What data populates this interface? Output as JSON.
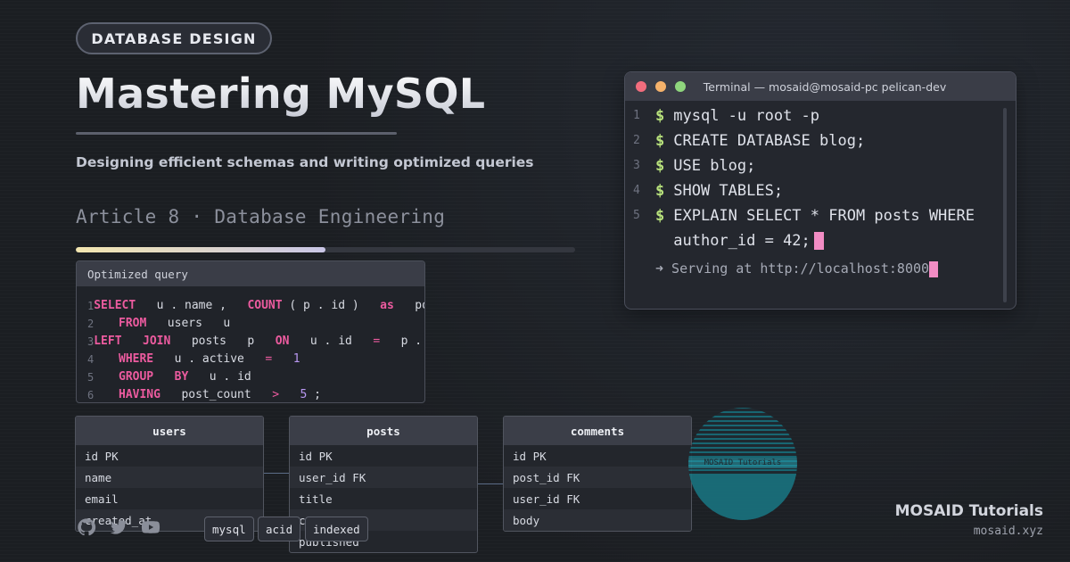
{
  "header": {
    "category": "DATABASE DESIGN",
    "title": "Mastering MySQL",
    "subtitle": "Designing efficient schemas and writing optimized queries",
    "article": "Article 8 · Database Engineering",
    "reading_progress": 0.5
  },
  "query_card": {
    "title": "Optimized query",
    "lines": [
      {
        "n": "1",
        "tokens": [
          [
            "kw",
            "SELECT"
          ],
          [
            "id",
            "   u . name ,   "
          ],
          [
            "kw",
            "COUNT"
          ],
          [
            "id",
            " ( p . id )   "
          ],
          [
            "kw",
            "as"
          ],
          [
            "id",
            "   post_count"
          ]
        ]
      },
      {
        "n": "2",
        "tokens": [
          [
            "kw",
            "FROM"
          ],
          [
            "id",
            "   users   u"
          ]
        ]
      },
      {
        "n": "3",
        "tokens": [
          [
            "kw",
            "LEFT"
          ],
          [
            "id",
            "   "
          ],
          [
            "kw",
            "JOIN"
          ],
          [
            "id",
            "   posts   p   "
          ],
          [
            "kw",
            "ON"
          ],
          [
            "id",
            "   u . id   "
          ],
          [
            "op",
            "="
          ],
          [
            "id",
            "   p . user_id"
          ]
        ]
      },
      {
        "n": "4",
        "tokens": [
          [
            "kw",
            "WHERE"
          ],
          [
            "id",
            "   u . active   "
          ],
          [
            "op",
            "="
          ],
          [
            "id",
            "   "
          ],
          [
            "num",
            "1"
          ]
        ]
      },
      {
        "n": "5",
        "tokens": [
          [
            "kw",
            "GROUP"
          ],
          [
            "id",
            "   "
          ],
          [
            "kw",
            "BY"
          ],
          [
            "id",
            "   u . id"
          ]
        ]
      },
      {
        "n": "6",
        "tokens": [
          [
            "kw",
            "HAVING"
          ],
          [
            "id",
            "   post_count   "
          ],
          [
            "op",
            ">"
          ],
          [
            "id",
            "   "
          ],
          [
            "num",
            "5"
          ],
          [
            "id",
            " ;"
          ]
        ]
      }
    ]
  },
  "terminal": {
    "title": "Terminal — mosaid@mosaid-pc pelican-dev",
    "prompt": "$",
    "lines": [
      {
        "n": "1",
        "cmd": "mysql -u root -p"
      },
      {
        "n": "2",
        "cmd": "CREATE DATABASE blog;"
      },
      {
        "n": "3",
        "cmd": "USE blog;"
      },
      {
        "n": "4",
        "cmd": "SHOW TABLES;"
      },
      {
        "n": "5",
        "cmd": "EXPLAIN SELECT * FROM posts WHERE\nauthor_id = 42;"
      }
    ],
    "serving": "➜ Serving at http://localhost:8000",
    "colors": {
      "close": "#f26d7d",
      "minimize": "#f5b26b",
      "maximize": "#8fd67d",
      "prompt": "#b8e27c",
      "cursor": "#f28cc4"
    }
  },
  "schema": {
    "tables": [
      {
        "name": "users",
        "columns": [
          "id PK",
          "name",
          "email",
          "created_at"
        ]
      },
      {
        "name": "posts",
        "columns": [
          "id PK",
          "user_id FK",
          "title",
          "content",
          "published"
        ]
      },
      {
        "name": "comments",
        "columns": [
          "id PK",
          "post_id FK",
          "user_id FK",
          "body"
        ]
      }
    ]
  },
  "badge": {
    "label": "MOSAID Tutorials"
  },
  "tags": [
    "mysql",
    "acid",
    "indexed"
  ],
  "social": [
    "github-icon",
    "twitter-icon",
    "youtube-icon"
  ],
  "brand": {
    "name": "MOSAID Tutorials",
    "site": "mosaid.xyz"
  }
}
